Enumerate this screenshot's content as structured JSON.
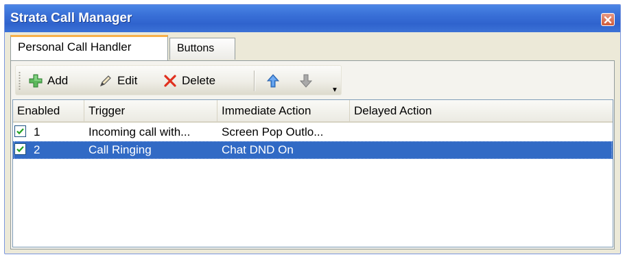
{
  "window": {
    "title": "Strata Call Manager",
    "accent_color": "#316ac5",
    "title_color": "#2f63cd"
  },
  "tabs": [
    {
      "label": "Personal Call Handler",
      "active": true
    },
    {
      "label": "Buttons",
      "active": false
    }
  ],
  "toolbar": {
    "add_label": "Add",
    "add_icon": "plus-icon",
    "edit_label": "Edit",
    "edit_icon": "pencil-icon",
    "delete_label": "Delete",
    "delete_icon": "x-icon",
    "move_up_icon": "arrow-up-icon",
    "move_down_icon": "arrow-down-icon",
    "overflow_icon": "chevron-down-icon"
  },
  "grid": {
    "columns": [
      "Enabled",
      "Trigger",
      "Immediate Action",
      "Delayed Action"
    ],
    "rows": [
      {
        "enabled": true,
        "number": "1",
        "trigger": "Incoming call with...",
        "immediate_action": "Screen Pop Outlo...",
        "delayed_action": "",
        "selected": false
      },
      {
        "enabled": true,
        "number": "2",
        "trigger": "Call Ringing",
        "immediate_action": "Chat DND On",
        "delayed_action": "",
        "selected": true
      }
    ]
  }
}
